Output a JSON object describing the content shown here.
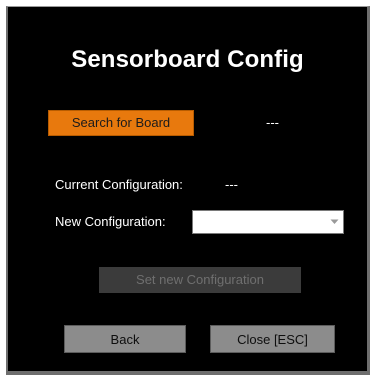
{
  "window": {
    "title": "Sensorboard Config"
  },
  "search": {
    "button_label": "Search for Board",
    "status": "---"
  },
  "current_config": {
    "label": "Current Configuration:",
    "value": "---"
  },
  "new_config": {
    "label": "New Configuration:",
    "selected": ""
  },
  "actions": {
    "set_label": "Set new Configuration",
    "back_label": "Back",
    "close_label": "Close [ESC]"
  },
  "colors": {
    "background": "#000000",
    "accent": "#e8790d",
    "button_gray": "#8c8c8c",
    "disabled_gray": "#3b3b3b"
  },
  "icons": {
    "combo_arrow": "chevron-down-icon"
  }
}
